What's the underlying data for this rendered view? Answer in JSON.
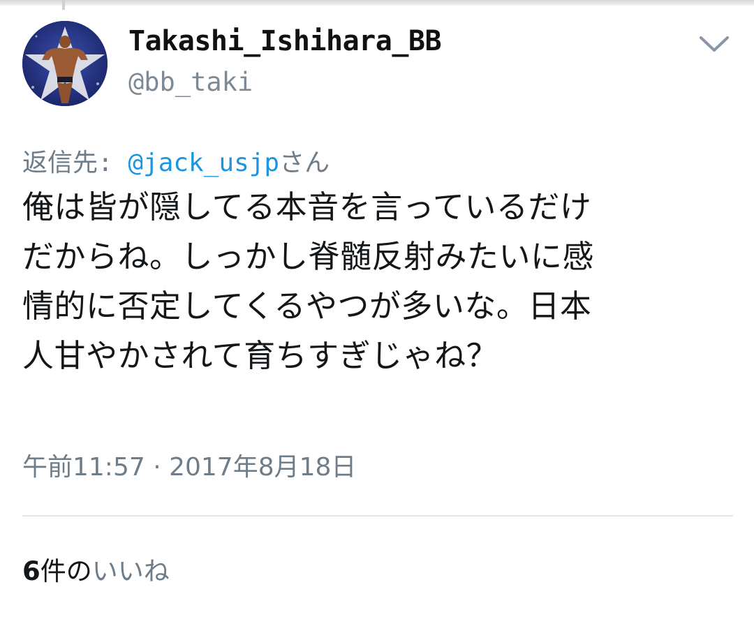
{
  "tweet": {
    "author": {
      "display_name": "Takashi_Ishihara_BB",
      "handle": "@bb_taki"
    },
    "reply": {
      "prefix": "返信先: ",
      "mention": "@jack_usjp",
      "suffix": "さん"
    },
    "text_lines": [
      "俺は皆が隠してる本音を言っているだけ",
      "だからね。しっかし脊髄反射みたいに感",
      "情的に否定してくるやつが多いな。日本",
      "人甘やかされて育ちすぎじゃね？"
    ],
    "timestamp": "午前11:57 · 2017年8月18日",
    "likes": {
      "count": "6",
      "unit": "件の",
      "label": "いいね"
    }
  },
  "icons": {
    "menu": "chevron-down-icon"
  },
  "colors": {
    "mention": "#1b95e0",
    "secondary_text": "#6e7d89",
    "primary_text": "#14171a",
    "divider": "#e1e8ed"
  }
}
